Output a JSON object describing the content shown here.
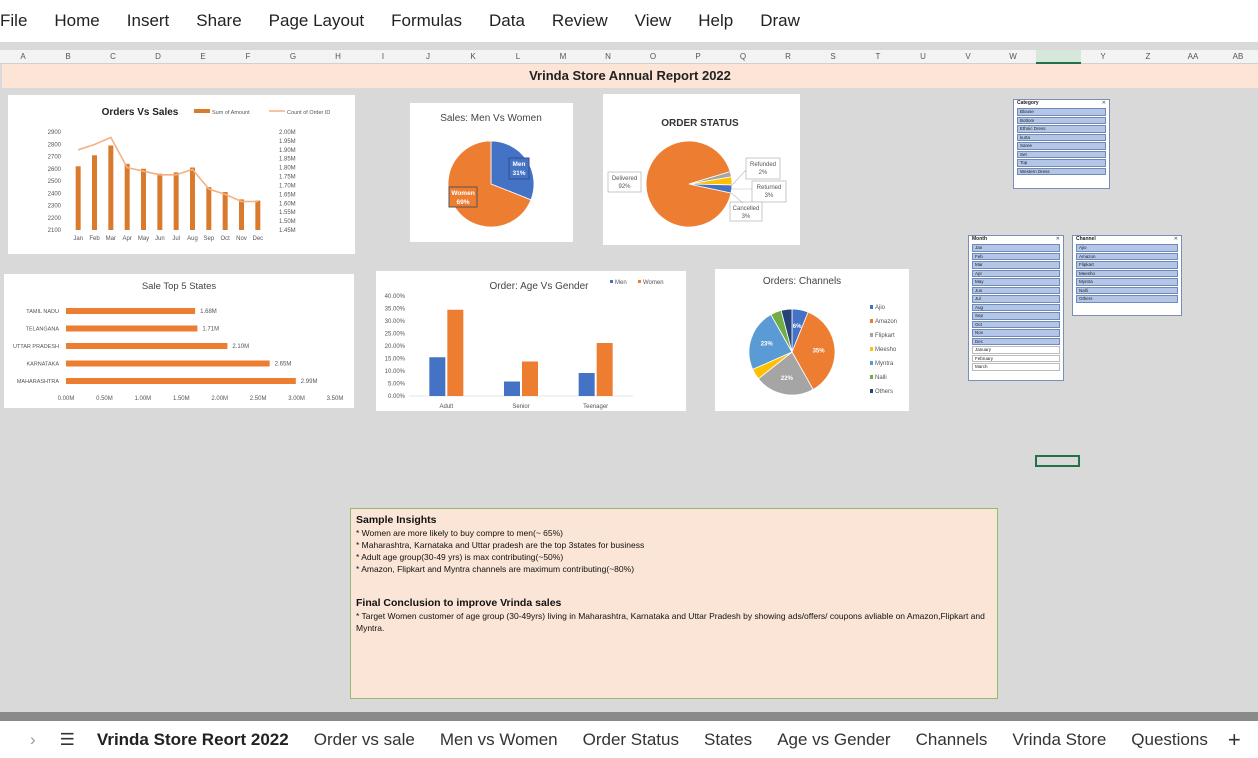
{
  "ribbon": {
    "tabs": [
      "File",
      "Home",
      "Insert",
      "Share",
      "Page Layout",
      "Formulas",
      "Data",
      "Review",
      "View",
      "Help",
      "Draw"
    ]
  },
  "columns": [
    "A",
    "B",
    "C",
    "D",
    "E",
    "F",
    "G",
    "H",
    "I",
    "J",
    "K",
    "L",
    "M",
    "N",
    "O",
    "P",
    "Q",
    "R",
    "S",
    "T",
    "U",
    "V",
    "W",
    "X",
    "Y",
    "Z",
    "AA",
    "AB"
  ],
  "selected_column": "X",
  "report_title": "Vrinda Store Annual Report 2022",
  "chart_data": [
    {
      "type": "bar",
      "title": "Orders Vs Sales",
      "categories": [
        "Jan",
        "Feb",
        "Mar",
        "Apr",
        "May",
        "Jun",
        "Jul",
        "Aug",
        "Sep",
        "Oct",
        "Nov",
        "Dec"
      ],
      "series": [
        {
          "name": "Sum of Amount",
          "type": "bar",
          "axis": "left",
          "values": [
            2620,
            2710,
            2790,
            2640,
            2600,
            2560,
            2570,
            2610,
            2450,
            2410,
            2350,
            2340
          ]
        },
        {
          "name": "Count of Order ID",
          "type": "line",
          "axis": "right",
          "values": [
            1.9,
            1.93,
            1.97,
            1.8,
            1.78,
            1.76,
            1.76,
            1.79,
            1.68,
            1.65,
            1.61,
            1.61
          ]
        }
      ],
      "ylim": [
        2100,
        2900
      ],
      "yticks": [
        "2900",
        "2800",
        "2700",
        "2600",
        "2500",
        "2400",
        "2300",
        "2200",
        "2100"
      ],
      "y2lim": [
        1.45,
        2.0
      ],
      "y2ticks": [
        "2.00M",
        "1.95M",
        "1.90M",
        "1.85M",
        "1.80M",
        "1.75M",
        "1.70M",
        "1.65M",
        "1.60M",
        "1.55M",
        "1.50M",
        "1.45M"
      ],
      "legend": "top-right",
      "colors": [
        "#d97b2d",
        "#f4b183"
      ]
    },
    {
      "type": "pie",
      "title": "Sales: Men Vs Women",
      "labels": [
        "Men",
        "Women"
      ],
      "values": [
        31,
        69
      ],
      "data_labels": [
        "31%",
        "69%"
      ],
      "colors": [
        "#4472c4",
        "#ed7d31"
      ]
    },
    {
      "type": "pie",
      "title": "ORDER STATUS",
      "labels": [
        "Delivered",
        "Refunded",
        "Returned",
        "Cancelled"
      ],
      "values": [
        92,
        2,
        3,
        3
      ],
      "data_labels": [
        "92%",
        "2%",
        "3%",
        "3%"
      ],
      "colors": [
        "#ed7d31",
        "#a5a5a5",
        "#ffc000",
        "#4472c4"
      ]
    },
    {
      "type": "bar",
      "orientation": "horizontal",
      "title": "Sale Top 5 States",
      "categories": [
        "TAMIL NADU",
        "TELANGANA",
        "UTTAR PRADESH",
        "KARNATAKA",
        "MAHARASHTRA"
      ],
      "values": [
        1.68,
        1.71,
        2.1,
        2.65,
        2.99
      ],
      "data_labels": [
        "1.68M",
        "1.71M",
        "2.10M",
        "2.65M",
        "2.99M"
      ],
      "xlim": [
        0,
        3.5
      ],
      "xticks": [
        "0.00M",
        "0.50M",
        "1.00M",
        "1.50M",
        "2.00M",
        "2.50M",
        "3.00M",
        "3.50M"
      ],
      "colors": [
        "#ed7d31"
      ]
    },
    {
      "type": "bar",
      "title": "Order: Age Vs Gender",
      "categories": [
        "Adult",
        "Senior",
        "Teenager"
      ],
      "series": [
        {
          "name": "Men",
          "values": [
            15.5,
            5.8,
            9.2
          ]
        },
        {
          "name": "Women",
          "values": [
            34.5,
            13.8,
            21.2
          ]
        }
      ],
      "ylim": [
        0,
        40
      ],
      "yticks": [
        "40.00%",
        "35.00%",
        "30.00%",
        "25.00%",
        "20.00%",
        "15.00%",
        "10.00%",
        "5.00%",
        "0.00%"
      ],
      "legend": "top-right",
      "colors": [
        "#4472c4",
        "#ed7d31"
      ]
    },
    {
      "type": "pie",
      "title": "Orders: Channels",
      "labels": [
        "Ajio",
        "Amazon",
        "Flipkart",
        "Meesho",
        "Myntra",
        "Nalli",
        "Others"
      ],
      "values": [
        6,
        35,
        22,
        4,
        23,
        4,
        4
      ],
      "data_labels": [
        "6%",
        "35%",
        "22%",
        "",
        "23%",
        "",
        ""
      ],
      "legend": "right",
      "colors": [
        "#4472c4",
        "#ed7d31",
        "#a5a5a5",
        "#ffc000",
        "#5b9bd5",
        "#70ad47",
        "#264478"
      ]
    }
  ],
  "slicers": {
    "category": {
      "title": "Category",
      "items": [
        {
          "label": "Blouse",
          "on": true
        },
        {
          "label": "Bottom",
          "on": true
        },
        {
          "label": "Ethnic Dress",
          "on": true
        },
        {
          "label": "kurta",
          "on": true
        },
        {
          "label": "Saree",
          "on": true
        },
        {
          "label": "Set",
          "on": true
        },
        {
          "label": "Top",
          "on": true
        },
        {
          "label": "Western Dress",
          "on": true
        }
      ]
    },
    "month": {
      "title": "Month",
      "items": [
        {
          "label": "Jan",
          "on": true
        },
        {
          "label": "Feb",
          "on": true
        },
        {
          "label": "Mar",
          "on": true
        },
        {
          "label": "Apr",
          "on": true
        },
        {
          "label": "May",
          "on": true
        },
        {
          "label": "Jun",
          "on": true
        },
        {
          "label": "Jul",
          "on": true
        },
        {
          "label": "Aug",
          "on": true
        },
        {
          "label": "Sep",
          "on": true
        },
        {
          "label": "Oct",
          "on": true
        },
        {
          "label": "Nov",
          "on": true
        },
        {
          "label": "Dec",
          "on": true
        },
        {
          "label": "January",
          "on": false
        },
        {
          "label": "February",
          "on": false
        },
        {
          "label": "March",
          "on": false
        }
      ]
    },
    "channel": {
      "title": "Channel",
      "items": [
        {
          "label": "Ajio",
          "on": true
        },
        {
          "label": "Amazon",
          "on": true
        },
        {
          "label": "Flipkart",
          "on": true
        },
        {
          "label": "Meesho",
          "on": true
        },
        {
          "label": "Myntra",
          "on": true
        },
        {
          "label": "Nalli",
          "on": true
        },
        {
          "label": "Others",
          "on": true
        }
      ]
    }
  },
  "insights": {
    "heading": "Sample Insights",
    "lines": [
      "* Women are more likely to buy compre to men(~ 65%)",
      "* Maharashtra, Karnataka and Uttar pradesh are the top 3states for business",
      "* Adult age group(30-49 yrs) is max contributing(~50%)",
      "* Amazon, Flipkart and Myntra channels are maximum contributing(~80%)"
    ],
    "conclusion_heading": "Final Conclusion to improve Vrinda sales",
    "conclusion": "* Target Women customer of age group (30-49yrs) living in Maharashtra, Karnataka and Uttar Pradesh by showing ads/offers/ coupons avliable on Amazon,Flipkart and Myntra."
  },
  "sheet_tabs": {
    "nav_prev": "›",
    "menu": "☰",
    "tabs": [
      "Vrinda Store Reort 2022",
      "Order vs sale",
      "Men vs Women",
      "Order Status",
      "States",
      "Age vs Gender",
      "Channels",
      "Vrinda Store",
      "Questions"
    ],
    "active": "Vrinda Store Reort 2022",
    "add": "+"
  }
}
